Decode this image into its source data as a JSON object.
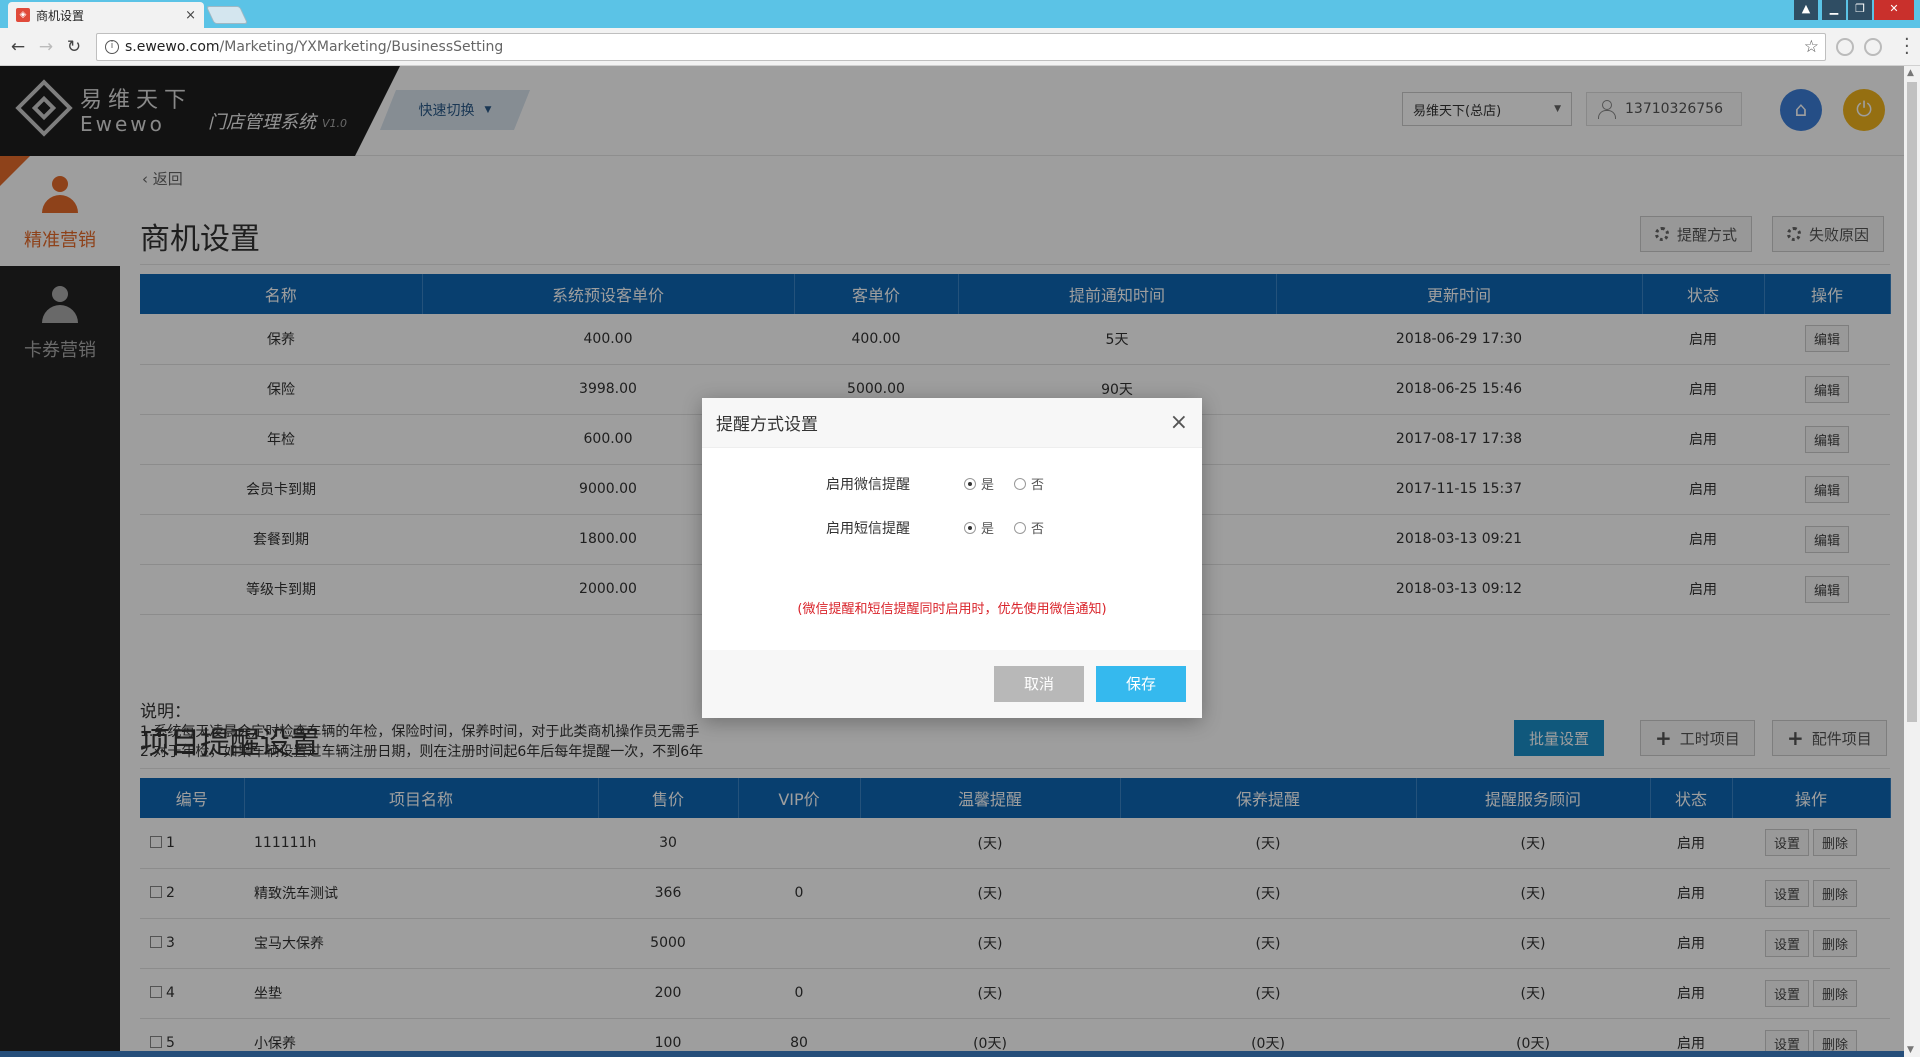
{
  "browser": {
    "tab_title": "商机设置",
    "tab_close": "×",
    "url_host": "s.ewewo.com",
    "url_path": "/Marketing/YXMarketing/BusinessSetting"
  },
  "header": {
    "logo_cn": "易维天下",
    "logo_en": "Ewewo",
    "system_name": "门店管理系统",
    "system_version": "V1.0",
    "quick_switch": "快速切换",
    "store_select": "易维天下(总店)",
    "user_phone": "13710326756"
  },
  "sidebar": {
    "items": [
      {
        "label": "精准营销"
      },
      {
        "label": "卡券营销"
      }
    ]
  },
  "page": {
    "back": "返回",
    "title": "商机设置",
    "btn_remind_method": "提醒方式",
    "btn_fail_reason": "失败原因"
  },
  "business_table": {
    "headers": [
      "名称",
      "系统预设客单价",
      "客单价",
      "提前通知时间",
      "更新时间",
      "状态",
      "操作"
    ],
    "rows": [
      {
        "name": "保养",
        "preset": "400.00",
        "price": "400.00",
        "notice": "5天",
        "updated": "2018-06-29 17:30",
        "status": "启用",
        "op": "编辑"
      },
      {
        "name": "保险",
        "preset": "3998.00",
        "price": "5000.00",
        "notice": "90天",
        "updated": "2018-06-25 15:46",
        "status": "启用",
        "op": "编辑"
      },
      {
        "name": "年检",
        "preset": "600.00",
        "price": "",
        "notice": "",
        "updated": "2017-08-17 17:38",
        "status": "启用",
        "op": "编辑"
      },
      {
        "name": "会员卡到期",
        "preset": "9000.00",
        "price": "",
        "notice": "",
        "updated": "2017-11-15 15:37",
        "status": "启用",
        "op": "编辑"
      },
      {
        "name": "套餐到期",
        "preset": "1800.00",
        "price": "",
        "notice": "",
        "updated": "2018-03-13 09:21",
        "status": "启用",
        "op": "编辑"
      },
      {
        "name": "等级卡到期",
        "preset": "2000.00",
        "price": "",
        "notice": "",
        "updated": "2018-03-13 09:12",
        "status": "启用",
        "op": "编辑"
      }
    ]
  },
  "notes": {
    "title": "说明：",
    "line1": "1.系统每天凌晨会定时检查车辆的年检，保险时间，保养时间，对于此类商机操作员无需手",
    "line2": "2.对于年检，如果车辆设置过车辆注册日期，则在注册时间起6年后每年提醒一次，不到6年"
  },
  "project_section": {
    "title": "项目提醒设置",
    "btn_batch": "批量设置",
    "btn_labor": "工时项目",
    "btn_parts": "配件项目"
  },
  "project_table": {
    "headers": [
      "编号",
      "项目名称",
      "售价",
      "VIP价",
      "温馨提醒",
      "保养提醒",
      "提醒服务顾问",
      "状态",
      "操作"
    ],
    "rows": [
      {
        "no": "1",
        "name": "111111h",
        "price": "30",
        "vip": "",
        "warm": "(天)",
        "maint": "(天)",
        "advisor": "(天)",
        "status": "启用",
        "op1": "设置",
        "op2": "删除"
      },
      {
        "no": "2",
        "name": "精致洗车测试",
        "price": "366",
        "vip": "0",
        "warm": "(天)",
        "maint": "(天)",
        "advisor": "(天)",
        "status": "启用",
        "op1": "设置",
        "op2": "删除"
      },
      {
        "no": "3",
        "name": "宝马大保养",
        "price": "5000",
        "vip": "",
        "warm": "(天)",
        "maint": "(天)",
        "advisor": "(天)",
        "status": "启用",
        "op1": "设置",
        "op2": "删除"
      },
      {
        "no": "4",
        "name": "坐垫",
        "price": "200",
        "vip": "0",
        "warm": "(天)",
        "maint": "(天)",
        "advisor": "(天)",
        "status": "启用",
        "op1": "设置",
        "op2": "删除"
      },
      {
        "no": "5",
        "name": "小保养",
        "price": "100",
        "vip": "80",
        "warm": "(0天)",
        "maint": "(0天)",
        "advisor": "(0天)",
        "status": "启用",
        "op1": "设置",
        "op2": "删除"
      }
    ]
  },
  "dialog": {
    "title": "提醒方式设置",
    "close": "×",
    "wechat_label": "启用微信提醒",
    "sms_label": "启用短信提醒",
    "yes": "是",
    "no": "否",
    "wechat_value": "是",
    "sms_value": "是",
    "tip": "(微信提醒和短信提醒同时启用时，优先使用微信通知)",
    "cancel": "取消",
    "save": "保存"
  },
  "colors": {
    "accent_orange": "#e66b2b",
    "table_header_blue": "#0d66b4",
    "save_blue": "#35b9ee",
    "tip_red": "#d9232a"
  }
}
